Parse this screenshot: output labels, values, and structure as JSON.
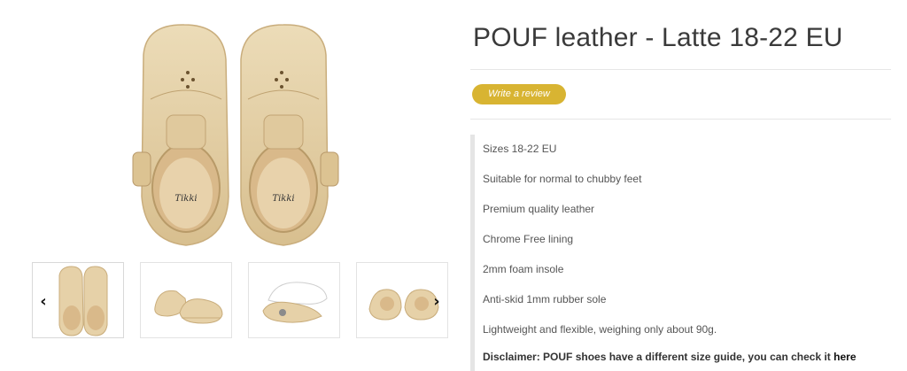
{
  "product": {
    "title": "POUF leather - Latte 18-22 EU",
    "review_button_label": "Write a review",
    "features": [
      "Sizes 18-22 EU",
      "Suitable for normal to chubby feet",
      "Premium quality leather",
      "Chrome Free lining",
      "2mm foam insole",
      "Anti-skid 1mm rubber sole",
      "Lightweight and flexible, weighing only about 90g."
    ],
    "disclaimer_text": "Disclaimer: POUF shoes have a different size guide, you can check it ",
    "disclaimer_link_label": "here"
  },
  "gallery": {
    "insole_brand": "Tikki",
    "prev_arrow": "‹",
    "next_arrow": "›",
    "thumbnails": [
      "top-view",
      "side-view",
      "sole-view",
      "back-view"
    ]
  },
  "colors": {
    "leather": "#e6d1a8",
    "leather_shadow": "#c9ad7c",
    "accent_button": "#d8b432"
  }
}
